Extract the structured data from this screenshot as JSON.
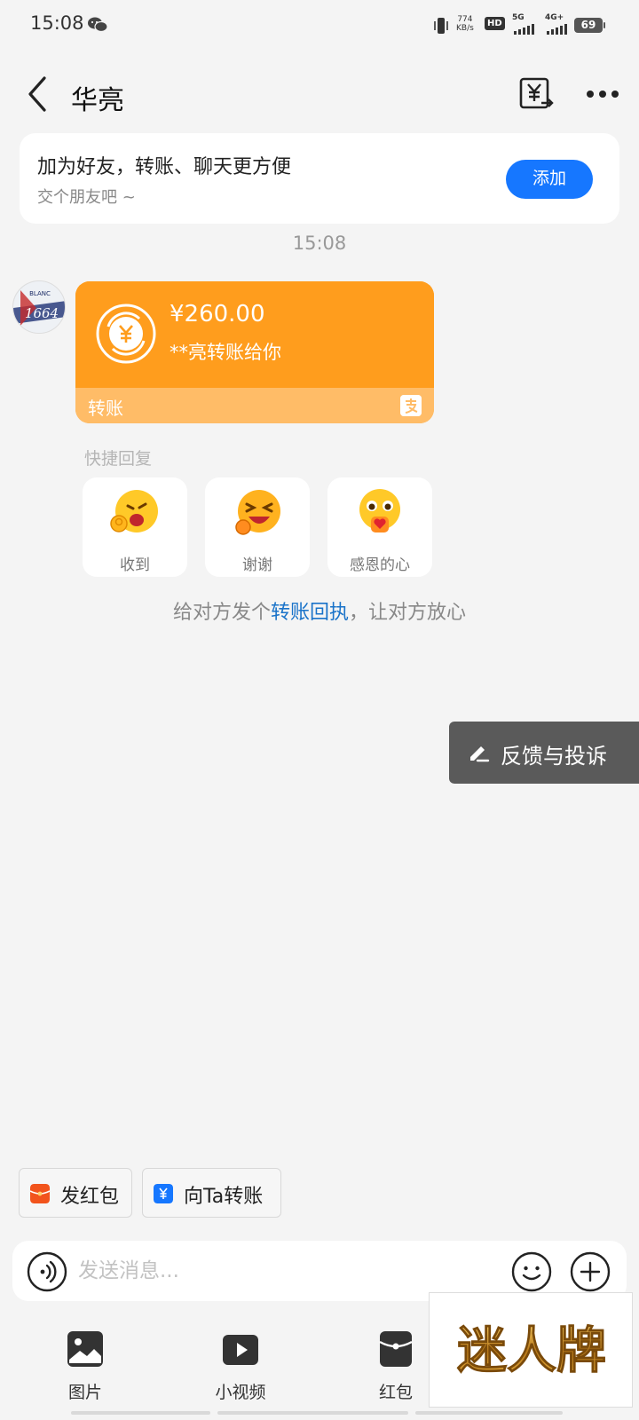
{
  "status_bar": {
    "time": "15:08",
    "net_speed_value": "774",
    "net_speed_unit": "KB/s",
    "hd_label": "HD",
    "signal1_label": "5G",
    "signal2_label": "4G+",
    "battery": "69"
  },
  "header": {
    "title": "华亮"
  },
  "friend_card": {
    "title": "加为好友，转账、聊天更方便",
    "subtitle": "交个朋友吧 ~",
    "add_label": "添加"
  },
  "chat": {
    "timestamp": "15:08",
    "avatar_text_top": "BLANC",
    "avatar_text_main": "1664",
    "transfer": {
      "amount": "¥260.00",
      "description": "**亮转账给你",
      "label": "转账"
    }
  },
  "quick_reply": {
    "title": "快捷回复",
    "items": [
      {
        "label": "收到"
      },
      {
        "label": "谢谢"
      },
      {
        "label": "感恩的心"
      }
    ]
  },
  "hint": {
    "prefix": "给对方发个",
    "link": "转账回执",
    "suffix": "，让对方放心"
  },
  "feedback": {
    "label": "反馈与投诉"
  },
  "action_chips": [
    {
      "label": "发红包",
      "color": "#f2541c"
    },
    {
      "label": "向Ta转账",
      "color": "#1677ff"
    }
  ],
  "input": {
    "placeholder": "发送消息..."
  },
  "toolbar": {
    "items": [
      {
        "label": "图片",
        "icon": "image-icon"
      },
      {
        "label": "小视频",
        "icon": "video-icon"
      },
      {
        "label": "红包",
        "icon": "red-packet-icon"
      }
    ]
  },
  "watermark": {
    "text": "迷人牌"
  },
  "colors": {
    "accent_blue": "#1677ff",
    "transfer_orange": "#ff9d1d",
    "transfer_footer": "#ffbc67",
    "link_blue": "#1a73c9"
  }
}
